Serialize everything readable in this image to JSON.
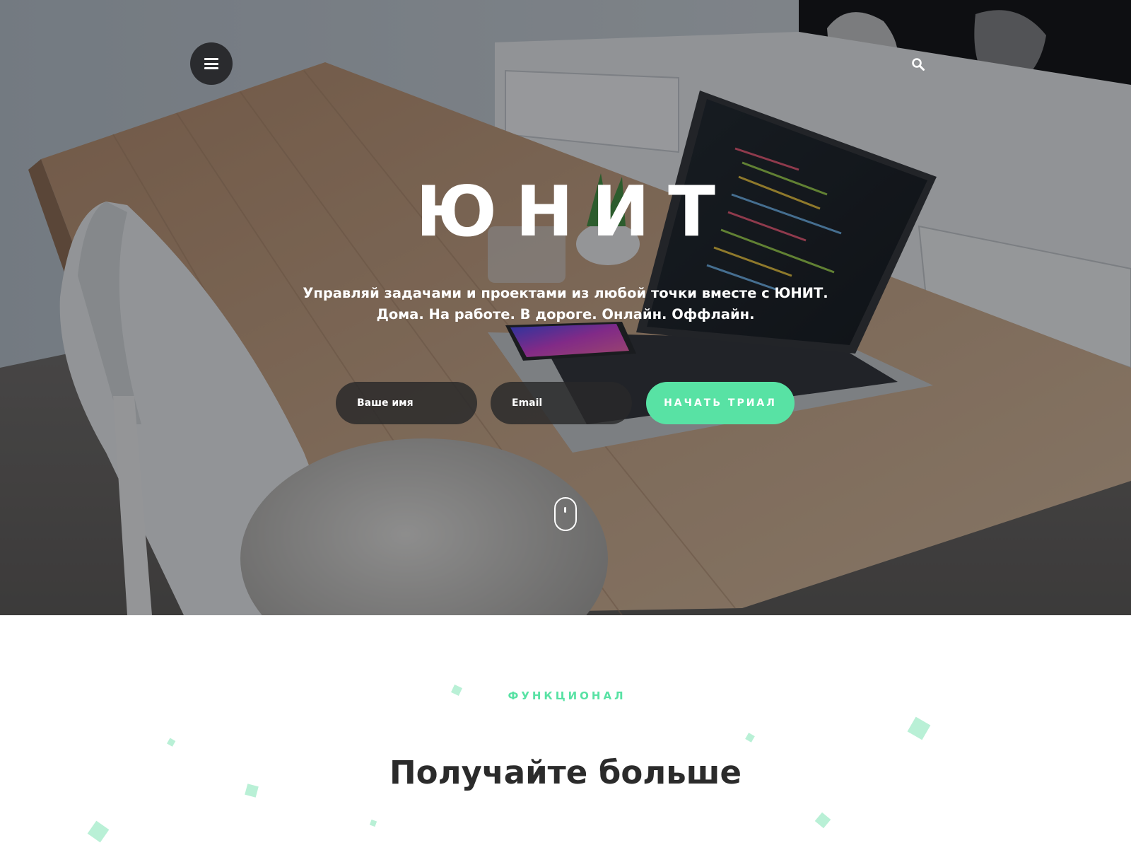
{
  "header": {
    "menu_icon": "hamburger-menu-icon",
    "search_icon": "search-icon"
  },
  "hero": {
    "title": "ЮНИТ",
    "subtitle_line1": "Управляй задачами и проектами из любой точки вместе с ЮНИТ.",
    "subtitle_line2": "Дома. На работе. В дороге. Онлайн. Оффлайн.",
    "name_placeholder": "Ваше имя",
    "email_placeholder": "Email",
    "cta_label": "НАЧАТЬ ТРИАЛ",
    "scroll_icon": "mouse-scroll-icon"
  },
  "features": {
    "eyebrow": "ФУНКЦИОНАЛ",
    "title": "Получайте больше"
  },
  "colors": {
    "accent": "#58e2a4",
    "menu_bg": "#2a2b2e",
    "field_bg": "#28282a",
    "heading": "#2b2b2b",
    "confetti": "#b9f0d6"
  }
}
